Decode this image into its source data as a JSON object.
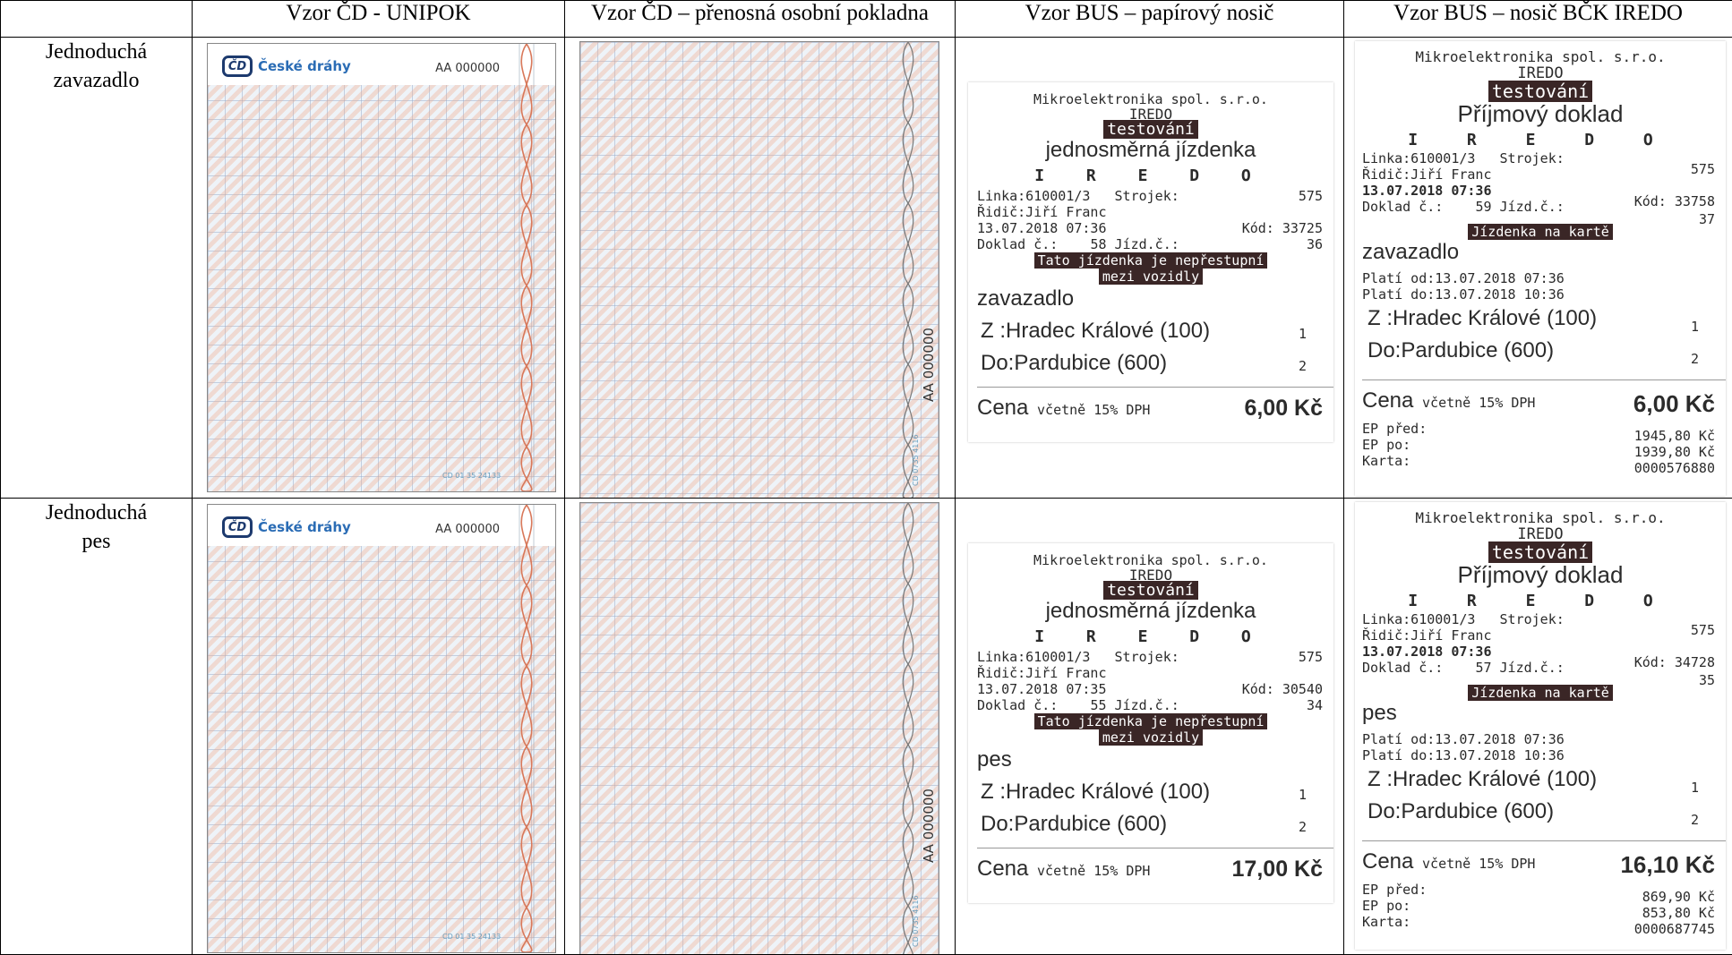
{
  "headers": [
    "",
    "Vzor ČD - UNIPOK",
    "Vzor ČD – přenosná osobní pokladna",
    "Vzor BUS – papírový nosič",
    "Vzor BUS – nosič BČK IREDO"
  ],
  "cd_ticket": {
    "brand": "České dráhy",
    "logo_text": "ČD",
    "serial": "AA 000000",
    "tiny_code": "CD 01 35 24133",
    "tiny_code_v": "CD 0735 4116"
  },
  "rows": [
    {
      "label_line1": "Jednoduchá",
      "label_line2": "zavazadlo",
      "paper": {
        "company": "Mikroelektronika spol. s.r.o.",
        "brand": "IREDO",
        "testing": "testování",
        "ticket_type": "jednosměrná jízdenka",
        "logo": "I R E D O",
        "linka": "Linka:610001/3",
        "strojek": "Strojek:",
        "strojek_val": "575",
        "ridic": "Řidič:Jiří Franc",
        "datetime": "13.07.2018 07:36",
        "kod": "Kód: 33725",
        "doklad": "Doklad č.:",
        "doklad_val": "58",
        "jizd": "Jízd.č.:",
        "jizd_val": "36",
        "notice1": "Tato jízdenka je nepřestupní",
        "notice2": "mezi vozidly",
        "item": "zavazadlo",
        "from": "Z :Hradec Králové (100)",
        "from_n": "1",
        "to": "Do:Pardubice (600)",
        "to_n": "2",
        "cena": "Cena",
        "dph": "včetně 15% DPH",
        "price": "6,00 Kč"
      },
      "card": {
        "company": "Mikroelektronika spol. s.r.o.",
        "brand": "IREDO",
        "testing": "testování",
        "title": "Příjmový doklad",
        "logo": "I R E D O",
        "linka": "Linka:610001/3",
        "strojek": "Strojek:",
        "strojek_val": "575",
        "ridic": "Řidič:Jiří Franc",
        "datetime": "13.07.2018 07:36",
        "kod": "Kód: 33758",
        "doklad": "Doklad č.:",
        "doklad_val": "59",
        "jizd": "Jízd.č.:",
        "jizd_val": "37",
        "on_card": "Jízdenka na kartě",
        "item": "zavazadlo",
        "plati_od": "Platí od:13.07.2018 07:36",
        "plati_do": "Platí do:13.07.2018 10:36",
        "from": "Z :Hradec Králové (100)",
        "from_n": "1",
        "to": "Do:Pardubice (600)",
        "to_n": "2",
        "cena": "Cena",
        "dph": "včetně 15% DPH",
        "price": "6,00 Kč",
        "ep_pred": "EP před:",
        "ep_pred_val": "1945,80 Kč",
        "ep_po": "EP po:",
        "ep_po_val": "1939,80 Kč",
        "karta": "Karta:",
        "karta_val": "0000576880"
      }
    },
    {
      "label_line1": "Jednoduchá",
      "label_line2": "pes",
      "paper": {
        "company": "Mikroelektronika spol. s.r.o.",
        "brand": "IREDO",
        "testing": "testování",
        "ticket_type": "jednosměrná jízdenka",
        "logo": "I R E D O",
        "linka": "Linka:610001/3",
        "strojek": "Strojek:",
        "strojek_val": "575",
        "ridic": "Řidič:Jiří Franc",
        "datetime": "13.07.2018 07:35",
        "kod": "Kód: 30540",
        "doklad": "Doklad č.:",
        "doklad_val": "55",
        "jizd": "Jízd.č.:",
        "jizd_val": "34",
        "notice1": "Tato jízdenka je nepřestupní",
        "notice2": "mezi vozidly",
        "item": "pes",
        "from": "Z :Hradec Králové (100)",
        "from_n": "1",
        "to": "Do:Pardubice (600)",
        "to_n": "2",
        "cena": "Cena",
        "dph": "včetně 15% DPH",
        "price": "17,00 Kč"
      },
      "card": {
        "company": "Mikroelektronika spol. s.r.o.",
        "brand": "IREDO",
        "testing": "testování",
        "title": "Příjmový doklad",
        "logo": "I R E D O",
        "linka": "Linka:610001/3",
        "strojek": "Strojek:",
        "strojek_val": "575",
        "ridic": "Řidič:Jiří Franc",
        "datetime": "13.07.2018 07:36",
        "kod": "Kód: 34728",
        "doklad": "Doklad č.:",
        "doklad_val": "57",
        "jizd": "Jízd.č.:",
        "jizd_val": "35",
        "on_card": "Jízdenka na kartě",
        "item": "pes",
        "plati_od": "Platí od:13.07.2018 07:36",
        "plati_do": "Platí do:13.07.2018 10:36",
        "from": "Z :Hradec Králové (100)",
        "from_n": "1",
        "to": "Do:Pardubice (600)",
        "to_n": "2",
        "cena": "Cena",
        "dph": "včetně 15% DPH",
        "price": "16,10 Kč",
        "ep_pred": "EP před:",
        "ep_pred_val": "869,90 Kč",
        "ep_po": "EP po:",
        "ep_po_val": "853,80 Kč",
        "karta": "Karta:",
        "karta_val": "0000687745"
      }
    }
  ]
}
